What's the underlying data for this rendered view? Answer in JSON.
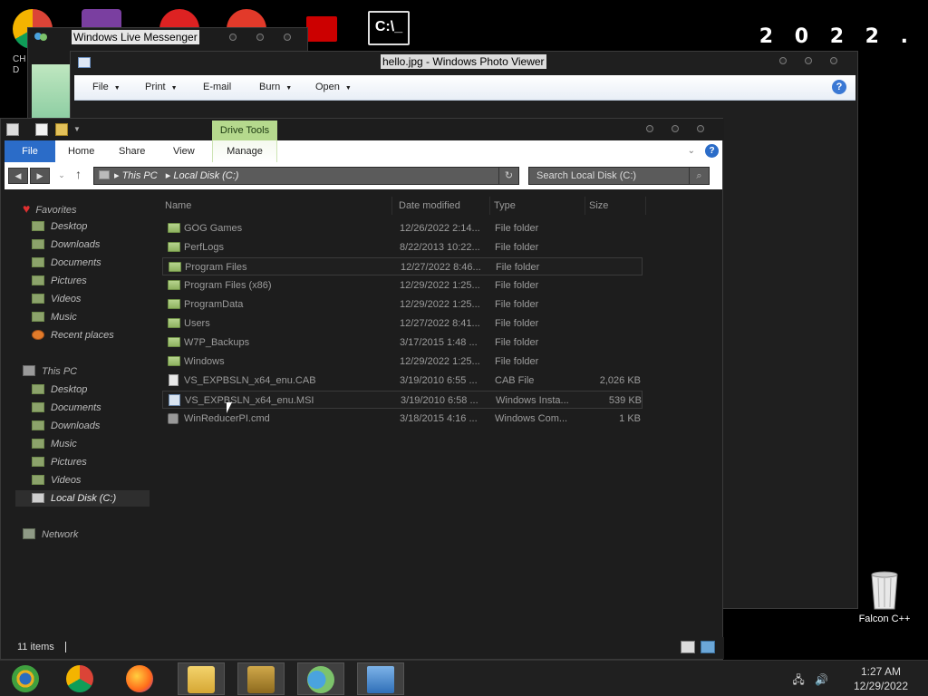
{
  "desktop": {
    "year_text": "2 0 2 2 .",
    "left_label": "CH\nD",
    "trash_label": "Falcon C++"
  },
  "messenger": {
    "title": "Windows Live Messenger"
  },
  "photo_viewer": {
    "title": "hello.jpg - Windows Photo Viewer",
    "menu": [
      {
        "label": "File",
        "has_arrow": true
      },
      {
        "label": "Print",
        "has_arrow": true
      },
      {
        "label": "E-mail",
        "has_arrow": false
      },
      {
        "label": "Burn",
        "has_arrow": true
      },
      {
        "label": "Open",
        "has_arrow": true
      }
    ],
    "help": "?"
  },
  "explorer": {
    "contextual_tab_group": "Drive Tools",
    "ribbon_tabs": [
      "File",
      "Home",
      "Share",
      "View",
      "Manage"
    ],
    "address": {
      "segments": [
        "This PC",
        "Local Disk (C:)"
      ]
    },
    "search_placeholder": "Search Local Disk (C:)",
    "nav": {
      "favorites": "Favorites",
      "favorites_items": [
        "Desktop",
        "Downloads",
        "Documents",
        "Pictures",
        "Videos",
        "Music",
        "Recent places"
      ],
      "this_pc": "This PC",
      "this_pc_items": [
        "Desktop",
        "Documents",
        "Downloads",
        "Music",
        "Pictures",
        "Videos",
        "Local Disk (C:)"
      ],
      "network": "Network"
    },
    "columns": [
      "Name",
      "Date modified",
      "Type",
      "Size"
    ],
    "rows": [
      {
        "name": "GOG Games",
        "date": "12/26/2022 2:14...",
        "type": "File folder",
        "size": "",
        "icon": "folder"
      },
      {
        "name": "PerfLogs",
        "date": "8/22/2013 10:22...",
        "type": "File folder",
        "size": "",
        "icon": "folder"
      },
      {
        "name": "Program Files",
        "date": "12/27/2022 8:46...",
        "type": "File folder",
        "size": "",
        "icon": "folder"
      },
      {
        "name": "Program Files (x86)",
        "date": "12/29/2022 1:25...",
        "type": "File folder",
        "size": "",
        "icon": "folder"
      },
      {
        "name": "ProgramData",
        "date": "12/29/2022 1:25...",
        "type": "File folder",
        "size": "",
        "icon": "folder"
      },
      {
        "name": "Users",
        "date": "12/27/2022 8:41...",
        "type": "File folder",
        "size": "",
        "icon": "folder"
      },
      {
        "name": "W7P_Backups",
        "date": "3/17/2015 1:48 ...",
        "type": "File folder",
        "size": "",
        "icon": "folder"
      },
      {
        "name": "Windows",
        "date": "12/29/2022 1:25...",
        "type": "File folder",
        "size": "",
        "icon": "folder"
      },
      {
        "name": "VS_EXPBSLN_x64_enu.CAB",
        "date": "3/19/2010 6:55 ...",
        "type": "CAB File",
        "size": "2,026 KB",
        "icon": "file"
      },
      {
        "name": "VS_EXPBSLN_x64_enu.MSI",
        "date": "3/19/2010 6:58 ...",
        "type": "Windows Insta...",
        "size": "539 KB",
        "icon": "msi"
      },
      {
        "name": "WinReducerPI.cmd",
        "date": "3/18/2015 4:16 ...",
        "type": "Windows Com...",
        "size": "1 KB",
        "icon": "cmd"
      }
    ],
    "status": "11 items"
  },
  "taskbar": {
    "items": [
      "start-icon",
      "chrome-icon",
      "firefox-icon",
      "file-explorer-icon",
      "lock-icon",
      "messenger-icon",
      "photo-viewer-icon"
    ],
    "time": "1:27 AM",
    "date": "12/29/2022"
  }
}
